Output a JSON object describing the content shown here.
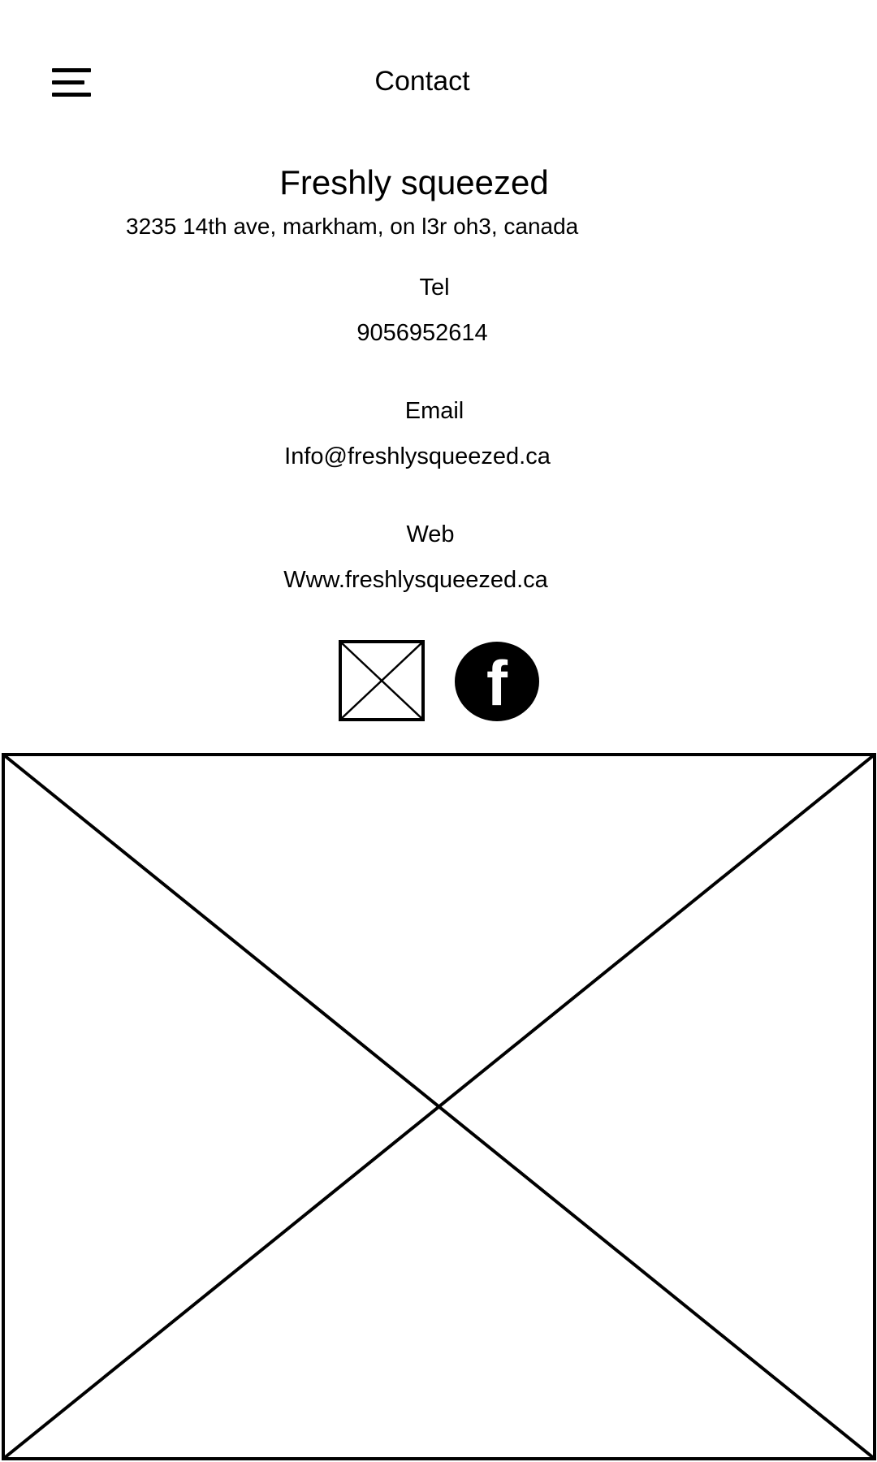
{
  "header": {
    "title": "Contact",
    "menu_icon": "hamburger-menu-icon"
  },
  "business": {
    "name": "Freshly squeezed",
    "address": "3235 14th ave, markham, on l3r oh3, canada"
  },
  "contact": {
    "tel_label": "Tel",
    "tel_value": "9056952614",
    "email_label": "Email",
    "email_value": "Info@freshlysqueezed.ca",
    "web_label": "Web",
    "web_value": "Www.freshlysqueezed.ca"
  },
  "social": {
    "icons": [
      "image-placeholder-icon",
      "facebook-icon"
    ],
    "facebook_letter": "f"
  },
  "colors": {
    "foreground": "#000000",
    "background": "#ffffff"
  }
}
